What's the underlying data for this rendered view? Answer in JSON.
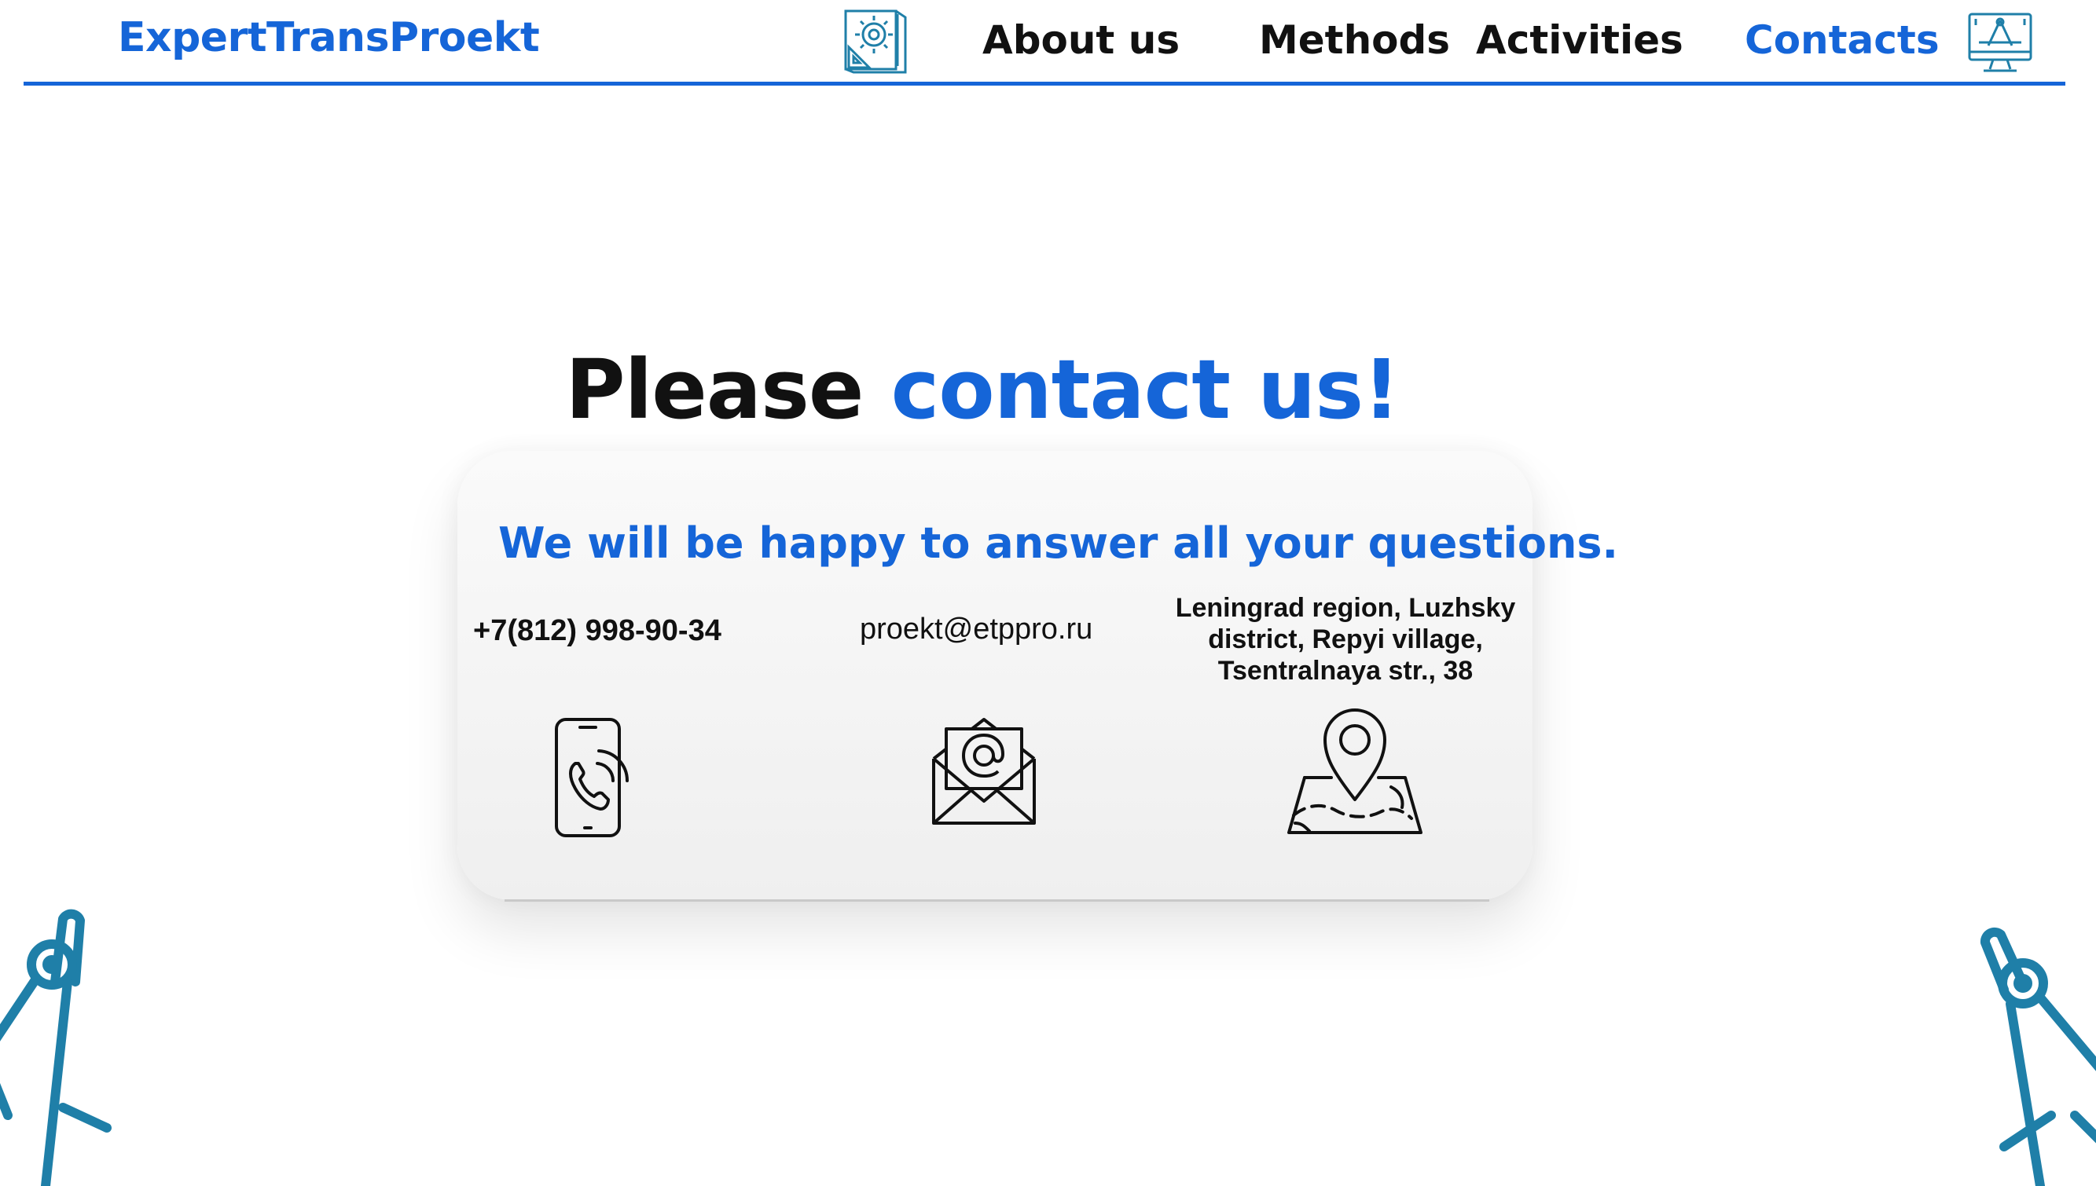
{
  "header": {
    "logo": "ExpertTransProekt",
    "nav": [
      {
        "label": "About us"
      },
      {
        "label": "Methods"
      },
      {
        "label": "Activities"
      },
      {
        "label": "Contacts",
        "active": true
      }
    ]
  },
  "main": {
    "headline_part1": "Please ",
    "headline_part2": "contact us!",
    "subtitle": "We will be happy to answer all your questions.",
    "phone": "+7(812) 998-90-34",
    "email": "proekt@etppro.ru",
    "address": "Leningrad region, Luzhsky district, Repyi village, Tsentralnaya str., 38"
  },
  "icons": {
    "header_left": "blueprint-gear-icon",
    "header_right": "monitor-design-icon",
    "phone": "phone-call-icon",
    "email": "email-envelope-icon",
    "address": "map-pin-icon",
    "decor": "drafting-compass-icon"
  },
  "colors": {
    "accent": "#1565d8",
    "text": "#111111",
    "icon_teal": "#1f7fa8"
  }
}
